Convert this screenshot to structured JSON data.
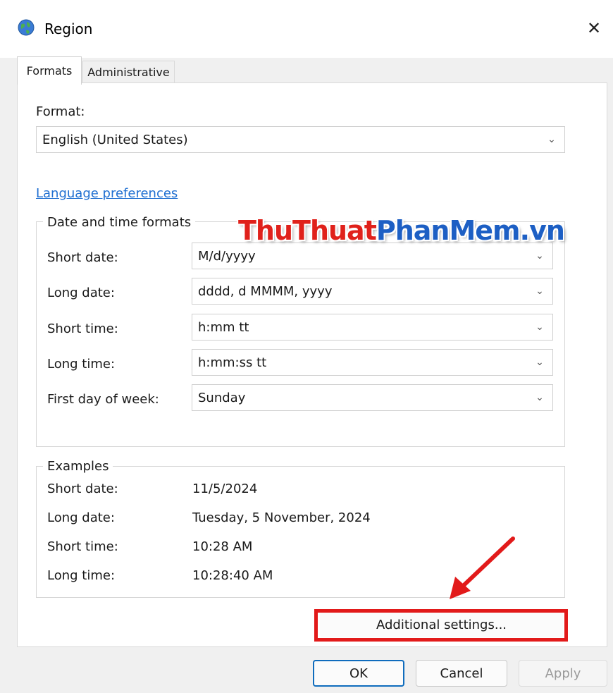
{
  "window": {
    "title": "Region",
    "close_glyph": "✕"
  },
  "tabs": [
    {
      "label": "Formats",
      "active": true
    },
    {
      "label": "Administrative",
      "active": false
    }
  ],
  "format": {
    "label": "Format:",
    "value": "English (United States)"
  },
  "language_link": "Language preferences",
  "date_time_formats": {
    "title": "Date and time formats",
    "rows": [
      {
        "label": "Short date:",
        "value": "M/d/yyyy"
      },
      {
        "label": "Long date:",
        "value": "dddd, d MMMM, yyyy"
      },
      {
        "label": "Short time:",
        "value": "h:mm tt"
      },
      {
        "label": "Long time:",
        "value": "h:mm:ss tt"
      },
      {
        "label": "First day of week:",
        "value": "Sunday"
      }
    ]
  },
  "examples": {
    "title": "Examples",
    "rows": [
      {
        "label": "Short date:",
        "value": "11/5/2024"
      },
      {
        "label": "Long date:",
        "value": "Tuesday, 5 November, 2024"
      },
      {
        "label": "Short time:",
        "value": "10:28 AM"
      },
      {
        "label": "Long time:",
        "value": "10:28:40 AM"
      }
    ]
  },
  "additional_settings_label": "Additional settings...",
  "watermark": {
    "part1": "ThuThuat",
    "part2": "PhanMem.vn"
  },
  "buttons": {
    "ok": "OK",
    "cancel": "Cancel",
    "apply": "Apply"
  },
  "colors": {
    "annotation_red": "#e21a1a",
    "link_blue": "#1f6fd1",
    "primary_border": "#0f6cbd"
  },
  "icons": {
    "window": "globe-icon",
    "chevron": "chevron-down-icon"
  }
}
